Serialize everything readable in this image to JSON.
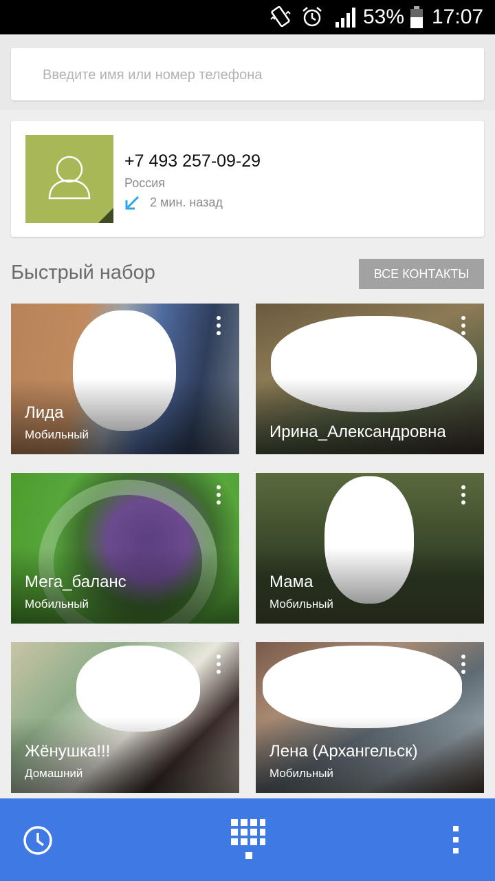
{
  "status_bar": {
    "battery_percent": "53%",
    "time": "17:07"
  },
  "search": {
    "placeholder": "Введите имя или номер телефона"
  },
  "recent_call": {
    "number": "+7 493 257-09-29",
    "location": "Россия",
    "when": "2 мин. назад"
  },
  "speed_dial": {
    "title": "Быстрый набор",
    "all_contacts_label": "ВСЕ КОНТАКТЫ",
    "contacts": [
      {
        "name": "Лида",
        "type": "Мобильный"
      },
      {
        "name": "Ирина_Александровна",
        "type": ""
      },
      {
        "name": "Мега_баланс",
        "type": "Мобильный"
      },
      {
        "name": "Мама",
        "type": "Мобильный"
      },
      {
        "name": "Жёнушка!!!",
        "type": "Домашний"
      },
      {
        "name": "Лена (Архангельск)",
        "type": "Мобильный"
      }
    ]
  },
  "colors": {
    "bottom_bar": "#3f79e3",
    "avatar_bg": "#a8b856",
    "accent_arrow": "#2aa7e0"
  },
  "icons": [
    "vibrate-icon",
    "alarm-icon",
    "signal-icon",
    "battery-icon",
    "person-icon",
    "incoming-call-arrow-icon",
    "more-vert-icon",
    "recent-calls-icon",
    "dialpad-icon"
  ]
}
